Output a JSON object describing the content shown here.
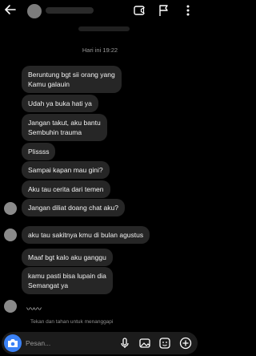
{
  "header": {
    "back_icon": "arrow-left-icon",
    "icons": [
      "video-call-icon",
      "flag-icon",
      "more-icon"
    ]
  },
  "timestamp": "Hari ini 19:22",
  "messages": [
    "Beruntung bgt sii orang yang",
    "Kamu galauin",
    "Udah ya buka hati ya",
    "Jangan takut, aku bantu",
    "Sembuhin trauma",
    "Plissss",
    "Sampai kapan mau gini?",
    "Aku tau cerita dari temen",
    "Jangan diliat doang chat aku?",
    "aku tau sakitnya kmu di bulan agustus",
    "Maaf bgt kalo aku ganggu",
    "kamu pasti bisa lupain dia",
    "Semangat ya"
  ],
  "reaction": "〰〰",
  "hint": "Tekan dan tahan untuk menanggapi",
  "composer": {
    "placeholder": "Pesan...",
    "icons": [
      "camera-icon",
      "microphone-icon",
      "image-icon",
      "sticker-icon",
      "plus-icon"
    ]
  },
  "colors": {
    "bubble": "#262626",
    "accent": "#3b82f6",
    "background": "#000000"
  }
}
